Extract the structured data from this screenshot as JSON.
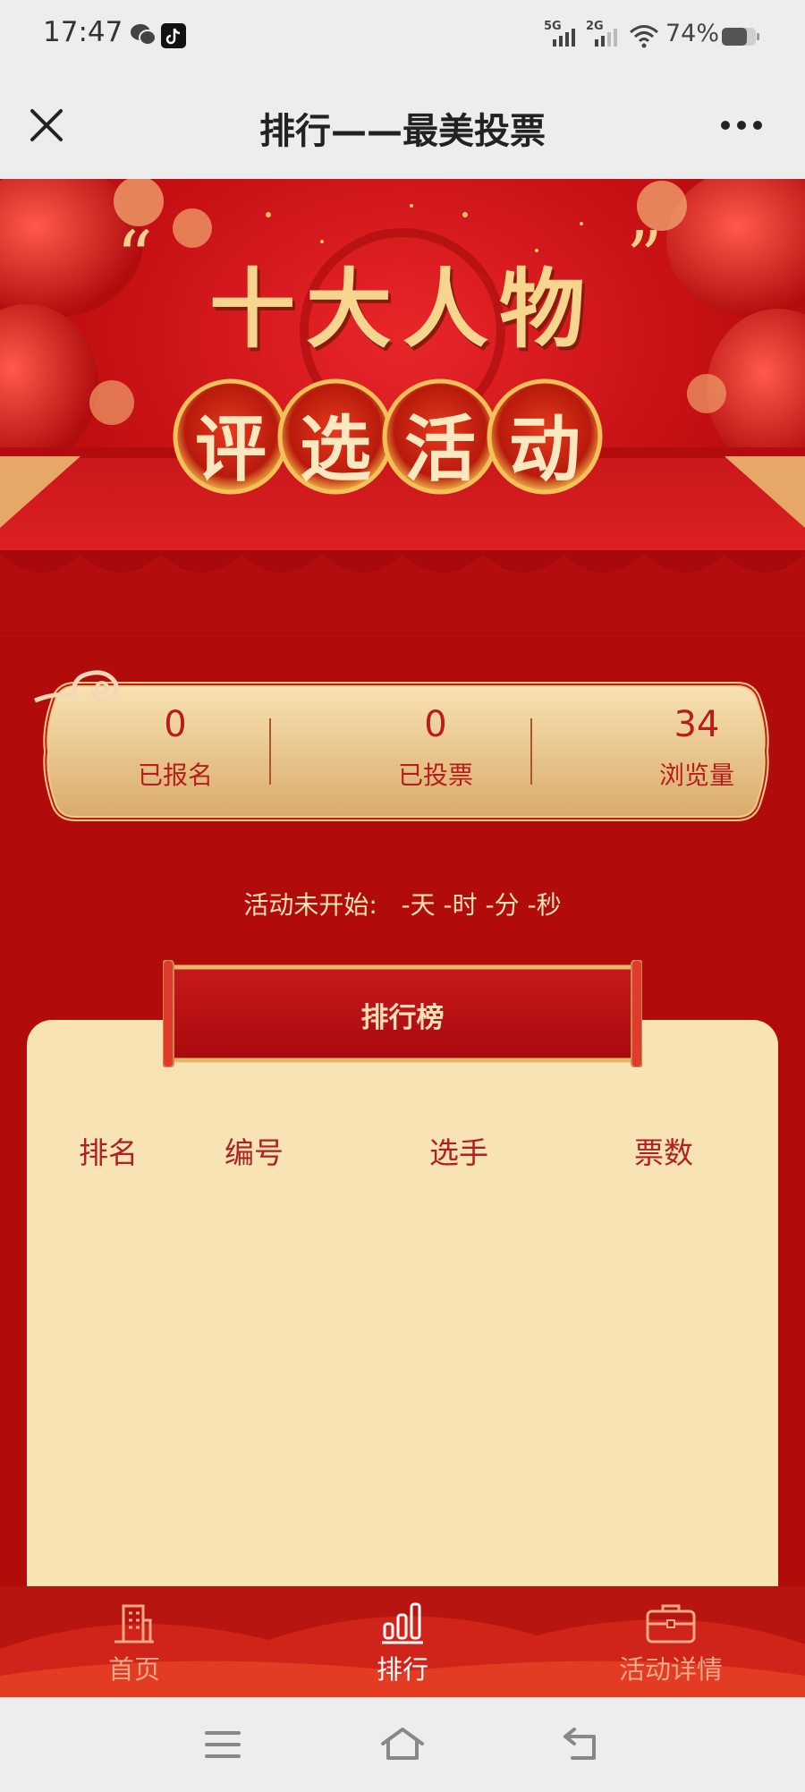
{
  "status_bar": {
    "time": "17:47",
    "signal1_label": "5G",
    "signal2_label": "2G",
    "battery": "74%"
  },
  "title_bar": {
    "title": "排行——最美投票"
  },
  "banner": {
    "headline": "十大人物",
    "subtitle_chars": [
      "评",
      "选",
      "活",
      "动"
    ]
  },
  "stats": {
    "registered_value": "0",
    "registered_label": "已报名",
    "voted_value": "0",
    "voted_label": "已投票",
    "views_value": "34",
    "views_label": "浏览量"
  },
  "countdown": {
    "text": "活动未开始:   -天 -时 -分 -秒"
  },
  "leaderboard": {
    "title": "排行榜",
    "columns": [
      "排名",
      "编号",
      "选手",
      "票数"
    ],
    "rows": []
  },
  "bottom_nav": {
    "home": "首页",
    "ranking": "排行",
    "details": "活动详情"
  },
  "colors": {
    "primary_red": "#b20b0c",
    "gold": "#e6b769",
    "board_bg": "#f7e3b3",
    "active_nav": "#ffffff",
    "inactive_nav": "#f1a98a"
  }
}
